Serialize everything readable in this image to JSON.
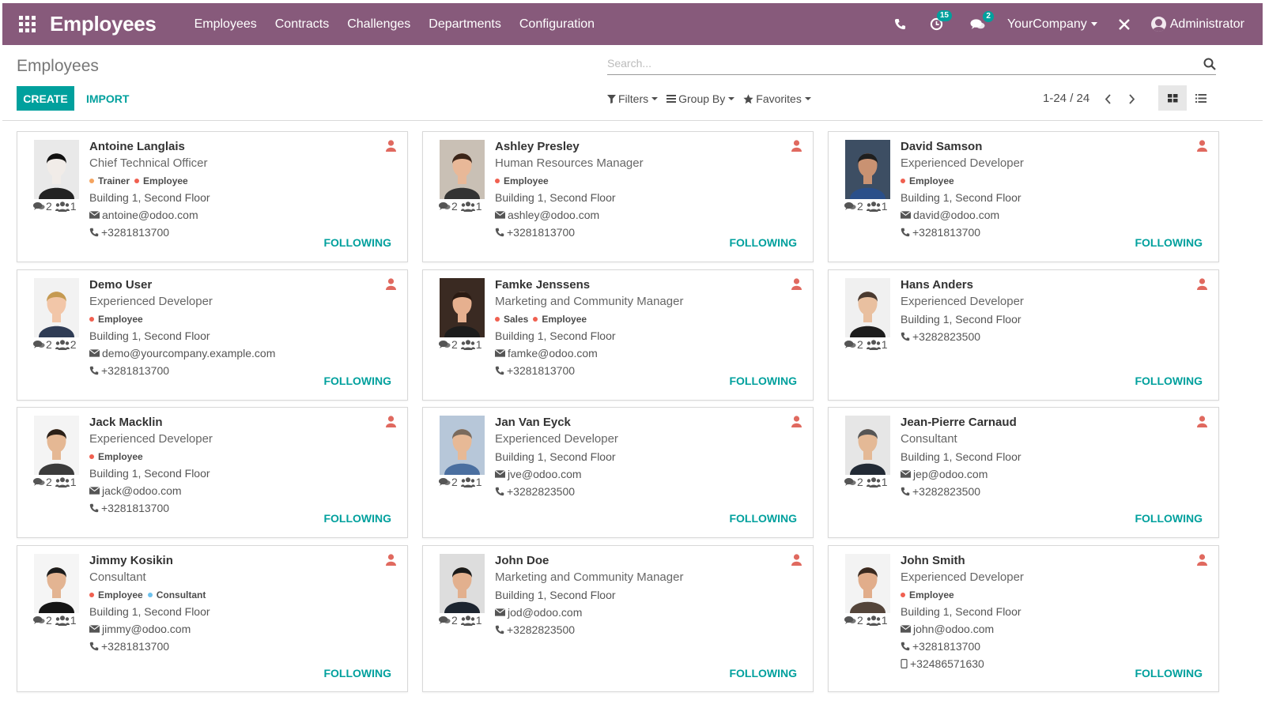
{
  "navbar": {
    "app_title": "Employees",
    "menu": [
      "Employees",
      "Contracts",
      "Challenges",
      "Departments",
      "Configuration"
    ],
    "activity_badge": "15",
    "messages_badge": "2",
    "company": "YourCompany",
    "user": "Administrator",
    "icons": [
      "apps-grid-icon",
      "phone-icon",
      "activity-clock-icon",
      "chat-bubbles-icon",
      "debug-close-icon"
    ]
  },
  "control_panel": {
    "breadcrumb": "Employees",
    "search_placeholder": "Search...",
    "create_label": "CREATE",
    "import_label": "IMPORT",
    "filters_label": "Filters",
    "groupby_label": "Group By",
    "favorites_label": "Favorites",
    "pager": "1-24 / 24"
  },
  "colors": {
    "brand": "#875a7b",
    "accent": "#00a09d",
    "presence": "#e0695f",
    "tag_orange": "#f4a460",
    "tag_red": "#f06050",
    "tag_blue": "#6cc1ed"
  },
  "following_label": "FOLLOWING",
  "employees": [
    {
      "name": "Antoine Langlais",
      "job": "Chief Technical Officer",
      "tags": [
        {
          "label": "Trainer",
          "color": "#f4a460"
        },
        {
          "label": "Employee",
          "color": "#f06050"
        }
      ],
      "location": "Building 1, Second Floor",
      "email": "antoine@odoo.com",
      "phone": "+3281813700",
      "mobile": "",
      "messages": "2",
      "followers": "1"
    },
    {
      "name": "Ashley Presley",
      "job": "Human Resources Manager",
      "tags": [
        {
          "label": "Employee",
          "color": "#f06050"
        }
      ],
      "location": "Building 1, Second Floor",
      "email": "ashley@odoo.com",
      "phone": "+3281813700",
      "mobile": "",
      "messages": "2",
      "followers": "1"
    },
    {
      "name": "David Samson",
      "job": "Experienced Developer",
      "tags": [
        {
          "label": "Employee",
          "color": "#f06050"
        }
      ],
      "location": "Building 1, Second Floor",
      "email": "david@odoo.com",
      "phone": "+3281813700",
      "mobile": "",
      "messages": "2",
      "followers": "1"
    },
    {
      "name": "Demo User",
      "job": "Experienced Developer",
      "tags": [
        {
          "label": "Employee",
          "color": "#f06050"
        }
      ],
      "location": "Building 1, Second Floor",
      "email": "demo@yourcompany.example.com",
      "phone": "+3281813700",
      "mobile": "",
      "messages": "2",
      "followers": "2"
    },
    {
      "name": "Famke Jenssens",
      "job": "Marketing and Community Manager",
      "tags": [
        {
          "label": "Sales",
          "color": "#f06050"
        },
        {
          "label": "Employee",
          "color": "#f06050"
        }
      ],
      "location": "Building 1, Second Floor",
      "email": "famke@odoo.com",
      "phone": "+3281813700",
      "mobile": "",
      "messages": "2",
      "followers": "1"
    },
    {
      "name": "Hans Anders",
      "job": "Experienced Developer",
      "tags": [],
      "location": "Building 1, Second Floor",
      "email": "",
      "phone": "+3282823500",
      "mobile": "",
      "messages": "2",
      "followers": "1"
    },
    {
      "name": "Jack Macklin",
      "job": "Experienced Developer",
      "tags": [
        {
          "label": "Employee",
          "color": "#f06050"
        }
      ],
      "location": "Building 1, Second Floor",
      "email": "jack@odoo.com",
      "phone": "+3281813700",
      "mobile": "",
      "messages": "2",
      "followers": "1"
    },
    {
      "name": "Jan Van Eyck",
      "job": "Experienced Developer",
      "tags": [],
      "location": "Building 1, Second Floor",
      "email": "jve@odoo.com",
      "phone": "+3282823500",
      "mobile": "",
      "messages": "2",
      "followers": "1"
    },
    {
      "name": "Jean-Pierre Carnaud",
      "job": "Consultant",
      "tags": [],
      "location": "Building 1, Second Floor",
      "email": "jep@odoo.com",
      "phone": "+3282823500",
      "mobile": "",
      "messages": "2",
      "followers": "1"
    },
    {
      "name": "Jimmy Kosikin",
      "job": "Consultant",
      "tags": [
        {
          "label": "Employee",
          "color": "#f06050"
        },
        {
          "label": "Consultant",
          "color": "#6cc1ed"
        }
      ],
      "location": "Building 1, Second Floor",
      "email": "jimmy@odoo.com",
      "phone": "+3281813700",
      "mobile": "",
      "messages": "2",
      "followers": "1"
    },
    {
      "name": "John Doe",
      "job": "Marketing and Community Manager",
      "tags": [],
      "location": "Building 1, Second Floor",
      "email": "jod@odoo.com",
      "phone": "+3282823500",
      "mobile": "",
      "messages": "2",
      "followers": "1"
    },
    {
      "name": "John Smith",
      "job": "Experienced Developer",
      "tags": [
        {
          "label": "Employee",
          "color": "#f06050"
        }
      ],
      "location": "Building 1, Second Floor",
      "email": "john@odoo.com",
      "phone": "+3281813700",
      "mobile": "+32486571630",
      "messages": "2",
      "followers": "1"
    }
  ]
}
